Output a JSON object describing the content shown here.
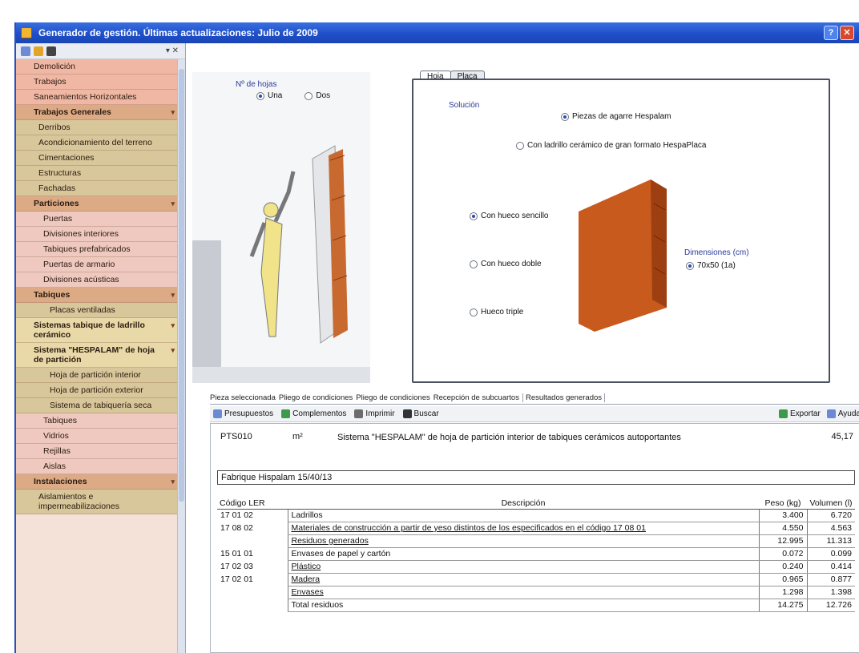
{
  "window": {
    "title": "Generador de gestión. Últimas actualizaciones: Julio de 2009"
  },
  "sidebar": {
    "items": [
      {
        "code": "",
        "label": "Demolición",
        "level": "lv0"
      },
      {
        "code": "",
        "label": "Trabajos",
        "level": "lv0"
      },
      {
        "code": "",
        "label": "Saneamientos Horizontales",
        "level": "lv0 check"
      },
      {
        "code": "",
        "label": "Trabajos Generales",
        "level": "lv-head"
      },
      {
        "code": "",
        "label": "Derribos",
        "level": "lv1"
      },
      {
        "code": "",
        "label": "Acondicionamiento del terreno",
        "level": "lv1"
      },
      {
        "code": "",
        "label": "Cimentaciones",
        "level": "lv1"
      },
      {
        "code": "",
        "label": "Estructuras",
        "level": "lv1"
      },
      {
        "code": "",
        "label": "Fachadas",
        "level": "lv1"
      },
      {
        "code": "",
        "label": "Particiones",
        "level": "lv-head"
      },
      {
        "code": "",
        "label": "Puertas",
        "level": "lv2"
      },
      {
        "code": "",
        "label": "Divisiones interiores",
        "level": "lv2"
      },
      {
        "code": "",
        "label": "Tabiques prefabricados",
        "level": "lv2"
      },
      {
        "code": "",
        "label": "Puertas de armario",
        "level": "lv2"
      },
      {
        "code": "",
        "label": "Divisiones acústicas",
        "level": "lv2"
      },
      {
        "code": "",
        "label": "Tabiques",
        "level": "lv-head"
      },
      {
        "code": "",
        "label": "Placas ventiladas",
        "level": "lv3"
      },
      {
        "code": "",
        "label": "Sistemas tabique de ladrillo cerámico",
        "level": "sel"
      },
      {
        "code": "",
        "label": "Sistema \"HESPALAM\" de hoja de partición",
        "level": "sel check"
      },
      {
        "code": "",
        "label": "Hoja de partición interior",
        "level": "lv3"
      },
      {
        "code": "",
        "label": "Hoja de partición exterior",
        "level": "lv3"
      },
      {
        "code": "",
        "label": "Sistema de tabiquería seca",
        "level": "lv3"
      },
      {
        "code": "",
        "label": "Tabiques",
        "level": "lv2"
      },
      {
        "code": "",
        "label": "Vidrios",
        "level": "lv2"
      },
      {
        "code": "",
        "label": "Rejillas",
        "level": "lv2"
      },
      {
        "code": "",
        "label": "Aislas",
        "level": "lv2"
      },
      {
        "code": "",
        "label": "Instalaciones",
        "level": "lv-head"
      },
      {
        "code": "",
        "label": "Aislamientos e impermeabilizaciones",
        "level": "lv1"
      }
    ]
  },
  "illustration": {
    "label": "Nº de hojas",
    "option_a": "Una",
    "option_b": "Dos"
  },
  "tabpanel": {
    "tab_active": "Hoja",
    "tab_inactive": "Placa",
    "group_label": "Solución",
    "opt1": "Piezas de agarre Hespalam",
    "opt2": "Con ladrillo cerámico de gran formato HespaPlaca",
    "opt3": "Con hueco sencillo",
    "opt4": "Con hueco doble",
    "opt5": "Hueco triple",
    "dimension_label": "Dimensiones (cm)",
    "dimension_value": "70x50 (1a)"
  },
  "bottom_tabs": [
    "Pieza seleccionada",
    "Pliego de condiciones",
    "Pliego de condiciones",
    "Recepción de subcuartos",
    "Resultados generados"
  ],
  "bottom_toolbar": {
    "b1": "Presupuestos",
    "b2": "Complementos",
    "b3": "Imprimir",
    "b4": "Buscar",
    "r1": "Exportar",
    "r2": "Ayuda"
  },
  "record": {
    "code": "PTS010",
    "unit": "m²",
    "description": "Sistema \"HESPALAM\" de hoja de partición interior de tabiques cerámicos autoportantes",
    "price": "45,17"
  },
  "subtitle": "Fabrique Hispalam 15/40/13",
  "table": {
    "headers": {
      "code": "Código LER",
      "desc": "Descripción",
      "weight": "Peso (kg)",
      "volume": "Volumen (l)"
    },
    "rows": [
      {
        "code": "17 01 02",
        "desc": "Ladrillos",
        "weight": "3.400",
        "volume": "6.720",
        "link": false,
        "sub": false
      },
      {
        "code": "17 08 02",
        "desc": "Materiales de construcción a partir de yeso distintos de los especificados en el código 17 08 01",
        "weight": "4.550",
        "volume": "4.563",
        "link": true,
        "sub": false
      },
      {
        "code": "",
        "desc": "Residuos generados",
        "weight": "12.995",
        "volume": "11.313",
        "link": true,
        "sub": true
      },
      {
        "code": "15 01 01",
        "desc": "Envases de papel y cartón",
        "weight": "0.072",
        "volume": "0.099",
        "link": false,
        "sub": false
      },
      {
        "code": "17 02 03",
        "desc": "Plástico",
        "weight": "0.240",
        "volume": "0.414",
        "link": true,
        "sub": false
      },
      {
        "code": "17 02 01",
        "desc": "Madera",
        "weight": "0.965",
        "volume": "0.877",
        "link": true,
        "sub": false
      },
      {
        "code": "",
        "desc": "Envases",
        "weight": "1.298",
        "volume": "1.398",
        "link": true,
        "sub": true
      },
      {
        "code": "",
        "desc": "Total residuos",
        "weight": "14.275",
        "volume": "12.726",
        "link": false,
        "sub": true
      }
    ]
  },
  "colors": {
    "titlebar": "#1f4fc9",
    "brick": "#c85a1e",
    "sidebar_pink": "#f0b8a4",
    "sidebar_tan": "#d8c79a"
  }
}
